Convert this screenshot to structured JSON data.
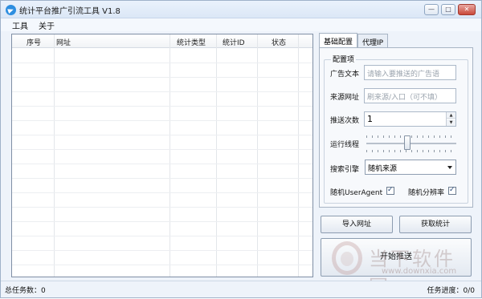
{
  "window": {
    "title": "统计平台推广引流工具 V1.8",
    "app_icon": "telegram-paper-plane-icon",
    "controls": {
      "minimize": "—",
      "maximize": "□",
      "close": "✕"
    }
  },
  "menu": {
    "items": [
      "工具",
      "关于"
    ]
  },
  "list": {
    "columns": [
      "序号",
      "网址",
      "统计类型",
      "统计ID",
      "状态"
    ],
    "rows": []
  },
  "tabs": [
    {
      "label": "基础配置",
      "active": true
    },
    {
      "label": "代理IP",
      "active": false
    }
  ],
  "config": {
    "group_label": "配置项",
    "ad_text": {
      "label": "广告文本",
      "placeholder": "请输入要推送的广告语",
      "value": ""
    },
    "source_url": {
      "label": "来源网址",
      "placeholder": "刷来源/入口（可不填）",
      "value": ""
    },
    "push_count": {
      "label": "推送次数",
      "value": "1"
    },
    "threads": {
      "label": "运行线程",
      "level": 0.45
    },
    "search_engine": {
      "label": "搜索引擎",
      "selected": "随机来源"
    },
    "random_useragent": {
      "label": "随机UserAgent",
      "checked": true
    },
    "random_resolution": {
      "label": "随机分辨率",
      "checked": true
    }
  },
  "buttons": {
    "import_urls": "导入网址",
    "get_stats": "获取统计",
    "start_push": "开始推送"
  },
  "watermark": {
    "text": "当下软件园",
    "url": "www.downxia.com"
  },
  "status": {
    "total_tasks": "总任务数：0",
    "progress": "任务进度：0/0"
  }
}
